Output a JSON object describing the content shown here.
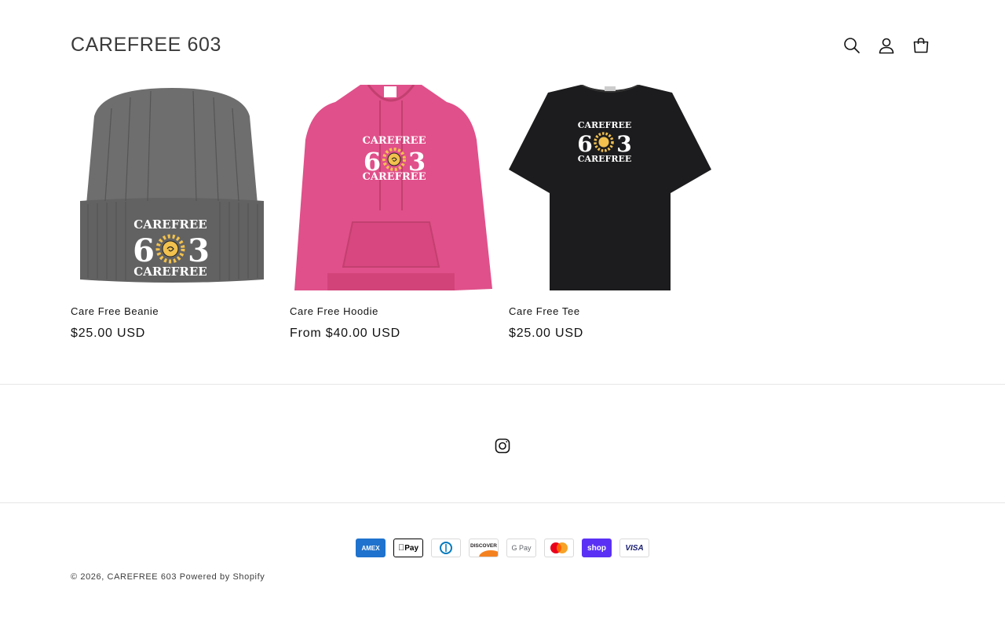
{
  "header": {
    "logo": "CAREFREE 603",
    "icons": [
      "search-icon",
      "account-icon",
      "cart-icon"
    ]
  },
  "products": [
    {
      "title": "Care Free Beanie",
      "price": "$25.00 USD",
      "image_text_top": "CAREFREE",
      "image_text_mid_left": "6",
      "image_text_mid_right": "3",
      "image_text_bottom": "CAREFREE"
    },
    {
      "title": "Care Free Hoodie",
      "price": "From $40.00 USD",
      "image_text_top": "CAREFREE",
      "image_text_mid_left": "6",
      "image_text_mid_right": "3",
      "image_text_bottom": "CAREFREE"
    },
    {
      "title": "Care Free Tee",
      "price": "$25.00 USD",
      "image_text_top": "CAREFREE",
      "image_text_mid_left": "6",
      "image_text_mid_right": "3",
      "image_text_bottom": "CAREFREE"
    }
  ],
  "footer": {
    "social": [
      "instagram-icon"
    ],
    "payment_methods": [
      {
        "name": "American Express",
        "label": "AMEX",
        "bg": "#1f72cd",
        "fg": "#ffffff"
      },
      {
        "name": "Apple Pay",
        "label": "Pay",
        "bg": "#ffffff",
        "fg": "#000000"
      },
      {
        "name": "Diners Club",
        "label": "D",
        "bg": "#ffffff",
        "fg": "#0079be"
      },
      {
        "name": "Discover",
        "label": "DISCOVER",
        "bg": "#ffffff",
        "fg": "#231f20"
      },
      {
        "name": "Google Pay",
        "label": "G Pay",
        "bg": "#ffffff",
        "fg": "#5f6368"
      },
      {
        "name": "Mastercard",
        "label": "",
        "bg": "#ffffff",
        "fg": "#000000"
      },
      {
        "name": "Shop Pay",
        "label": "shop",
        "bg": "#5a31f4",
        "fg": "#ffffff"
      },
      {
        "name": "Visa",
        "label": "VISA",
        "bg": "#ffffff",
        "fg": "#1a1f71"
      }
    ],
    "copyright_prefix": "© 2026,",
    "copyright_store": "CAREFREE 603",
    "powered_by": "Powered by Shopify"
  },
  "colors": {
    "beanie": "#6b6b6b",
    "hoodie": "#e0508a",
    "tee": "#1c1c1e",
    "sun": "#f2c14e",
    "divider": "#e6e6e6"
  }
}
